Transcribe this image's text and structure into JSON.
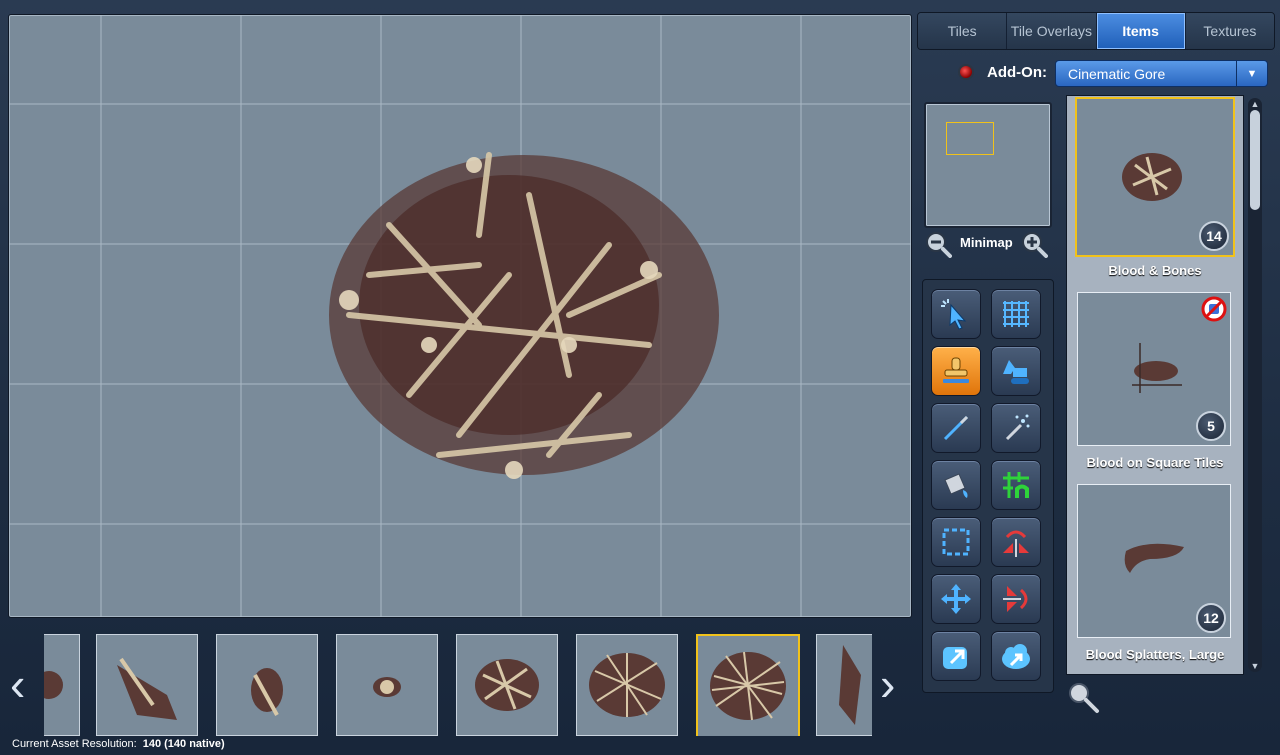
{
  "tabs": [
    {
      "label": "Tiles",
      "active": false
    },
    {
      "label": "Tile Overlays",
      "active": false
    },
    {
      "label": "Items",
      "active": true
    },
    {
      "label": "Textures",
      "active": false
    }
  ],
  "addon": {
    "label": "Add-On:",
    "value": "Cinematic Gore"
  },
  "minimap": {
    "label": "Minimap"
  },
  "tools": [
    {
      "name": "select-tool-icon",
      "active": false
    },
    {
      "name": "grid-tool-icon",
      "active": false
    },
    {
      "name": "stamp-tool-icon",
      "active": true
    },
    {
      "name": "excavator-tool-icon",
      "active": false
    },
    {
      "name": "pen-tool-icon",
      "active": false
    },
    {
      "name": "magic-wand-tool-icon",
      "active": false
    },
    {
      "name": "paint-bucket-tool-icon",
      "active": false
    },
    {
      "name": "grid-doorway-tool-icon",
      "active": false
    },
    {
      "name": "selection-rectangle-tool-icon",
      "active": false
    },
    {
      "name": "flip-horizontal-tool-icon",
      "active": false
    },
    {
      "name": "move-tool-icon",
      "active": false
    },
    {
      "name": "flip-vertical-tool-icon",
      "active": false
    },
    {
      "name": "export-tool-icon",
      "active": false
    },
    {
      "name": "cloud-export-tool-icon",
      "active": false
    }
  ],
  "assets": [
    {
      "label": "Blood & Bones",
      "count": "14",
      "selected": true,
      "no_random": false
    },
    {
      "label": "Blood on Square Tiles",
      "count": "5",
      "selected": false,
      "no_random": true
    },
    {
      "label": "Blood Splatters, Large",
      "count": "12",
      "selected": false,
      "no_random": false
    }
  ],
  "strip": {
    "selected_index": 6,
    "count": 8
  },
  "status": {
    "label": "Current Asset Resolution:",
    "value": "140 (140 native)"
  },
  "colors": {
    "accent": "#2a66c0",
    "selection": "#f1c21a",
    "canvas": "#7a8b9a"
  }
}
